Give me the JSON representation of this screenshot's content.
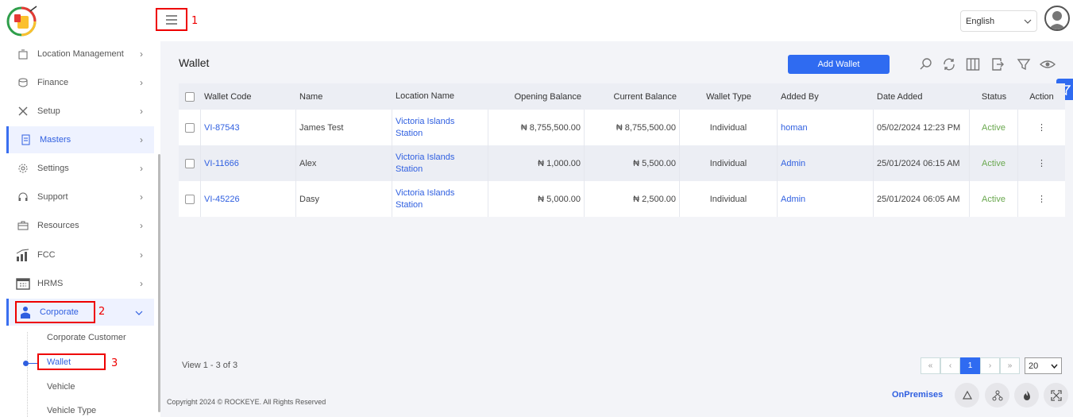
{
  "header": {
    "hamburger_annotation": "1",
    "language": "English"
  },
  "sidebar": {
    "items": [
      {
        "label": "Location Management"
      },
      {
        "label": "Finance"
      },
      {
        "label": "Setup"
      },
      {
        "label": "Masters"
      },
      {
        "label": "Settings"
      },
      {
        "label": "Support"
      },
      {
        "label": "Resources"
      },
      {
        "label": "FCC"
      },
      {
        "label": "HRMS"
      },
      {
        "label": "Corporate"
      }
    ],
    "corporate_annotation": "2",
    "sub_items": [
      {
        "label": "Corporate Customer"
      },
      {
        "label": "Wallet"
      },
      {
        "label": "Vehicle"
      },
      {
        "label": "Vehicle Type"
      }
    ],
    "wallet_annotation": "3"
  },
  "main": {
    "title": "Wallet",
    "add_button": "Add Wallet",
    "table": {
      "headers": [
        "Wallet Code",
        "Name",
        "Location Name",
        "Opening Balance",
        "Current Balance",
        "Wallet Type",
        "Added By",
        "Date Added",
        "Status",
        "Action"
      ],
      "rows": [
        {
          "code": "VI-87543",
          "name": "James Test",
          "loc1": "Victoria Islands",
          "loc2": "Station",
          "opening": "₦ 8,755,500.00",
          "current": "₦ 8,755,500.00",
          "type": "Individual",
          "added_by": "homan",
          "date": "05/02/2024 12:23 PM",
          "status": "Active",
          "action": "⋮"
        },
        {
          "code": "VI-11666",
          "name": "Alex",
          "loc1": "Victoria Islands",
          "loc2": "Station",
          "opening": "₦ 1,000.00",
          "current": "₦ 5,500.00",
          "type": "Individual",
          "added_by": "Admin",
          "date": "25/01/2024 06:15 AM",
          "status": "Active",
          "action": "⋮"
        },
        {
          "code": "VI-45226",
          "name": "Dasy",
          "loc1": "Victoria Islands",
          "loc2": "Station",
          "opening": "₦ 5,000.00",
          "current": "₦ 2,500.00",
          "type": "Individual",
          "added_by": "Admin",
          "date": "25/01/2024 06:05 AM",
          "status": "Active",
          "action": "⋮"
        }
      ]
    },
    "view_info": "View 1 - 3 of 3",
    "pagination": {
      "first": "«",
      "prev": "‹",
      "current": "1",
      "next": "›",
      "last": "»"
    },
    "per_page": "20"
  },
  "footer": {
    "copyright": "Copyright 2024 © ROCKEYE. All Rights Reserved",
    "mode": "OnPremises"
  },
  "colors": {
    "accent": "#2f6bf1",
    "annotation": "#ee0000",
    "active_status": "#6aa84f"
  }
}
